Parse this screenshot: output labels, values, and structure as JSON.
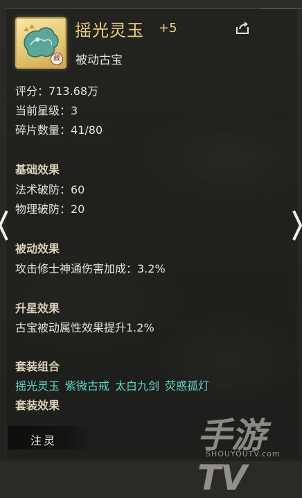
{
  "item": {
    "name": "摇光灵玉",
    "level": "+5",
    "type": "被动古宝",
    "badge": "藏",
    "icon": "jade-creature-icon"
  },
  "stats": [
    {
      "label": "评分：",
      "value": "713.68万"
    },
    {
      "label": "当前星级：",
      "value": "3"
    },
    {
      "label": "碎片数量：",
      "value": "41/80"
    }
  ],
  "basic": {
    "title": "基础效果",
    "lines": [
      "法术破防：60",
      "物理破防：20"
    ]
  },
  "passive": {
    "title": "被动效果",
    "lines": [
      "攻击修士神通伤害加成：3.2%"
    ]
  },
  "star_up": {
    "title": "升星效果",
    "lines": [
      "古宝被动属性效果提升1.2%"
    ]
  },
  "set_combo": {
    "title": "套装组合",
    "items": [
      "摇光灵玉",
      "紫微古戒",
      "太白九剑",
      "荧惑孤灯"
    ]
  },
  "set_effect": {
    "title": "套装效果"
  },
  "button": {
    "label": "注灵"
  },
  "watermark": {
    "main": "手游TV",
    "sub": "SHOUYOUTV.com"
  },
  "colors": {
    "accent": "#ecd27a",
    "set_text": "#5fd7c2",
    "body_text": "#e6e3da"
  }
}
